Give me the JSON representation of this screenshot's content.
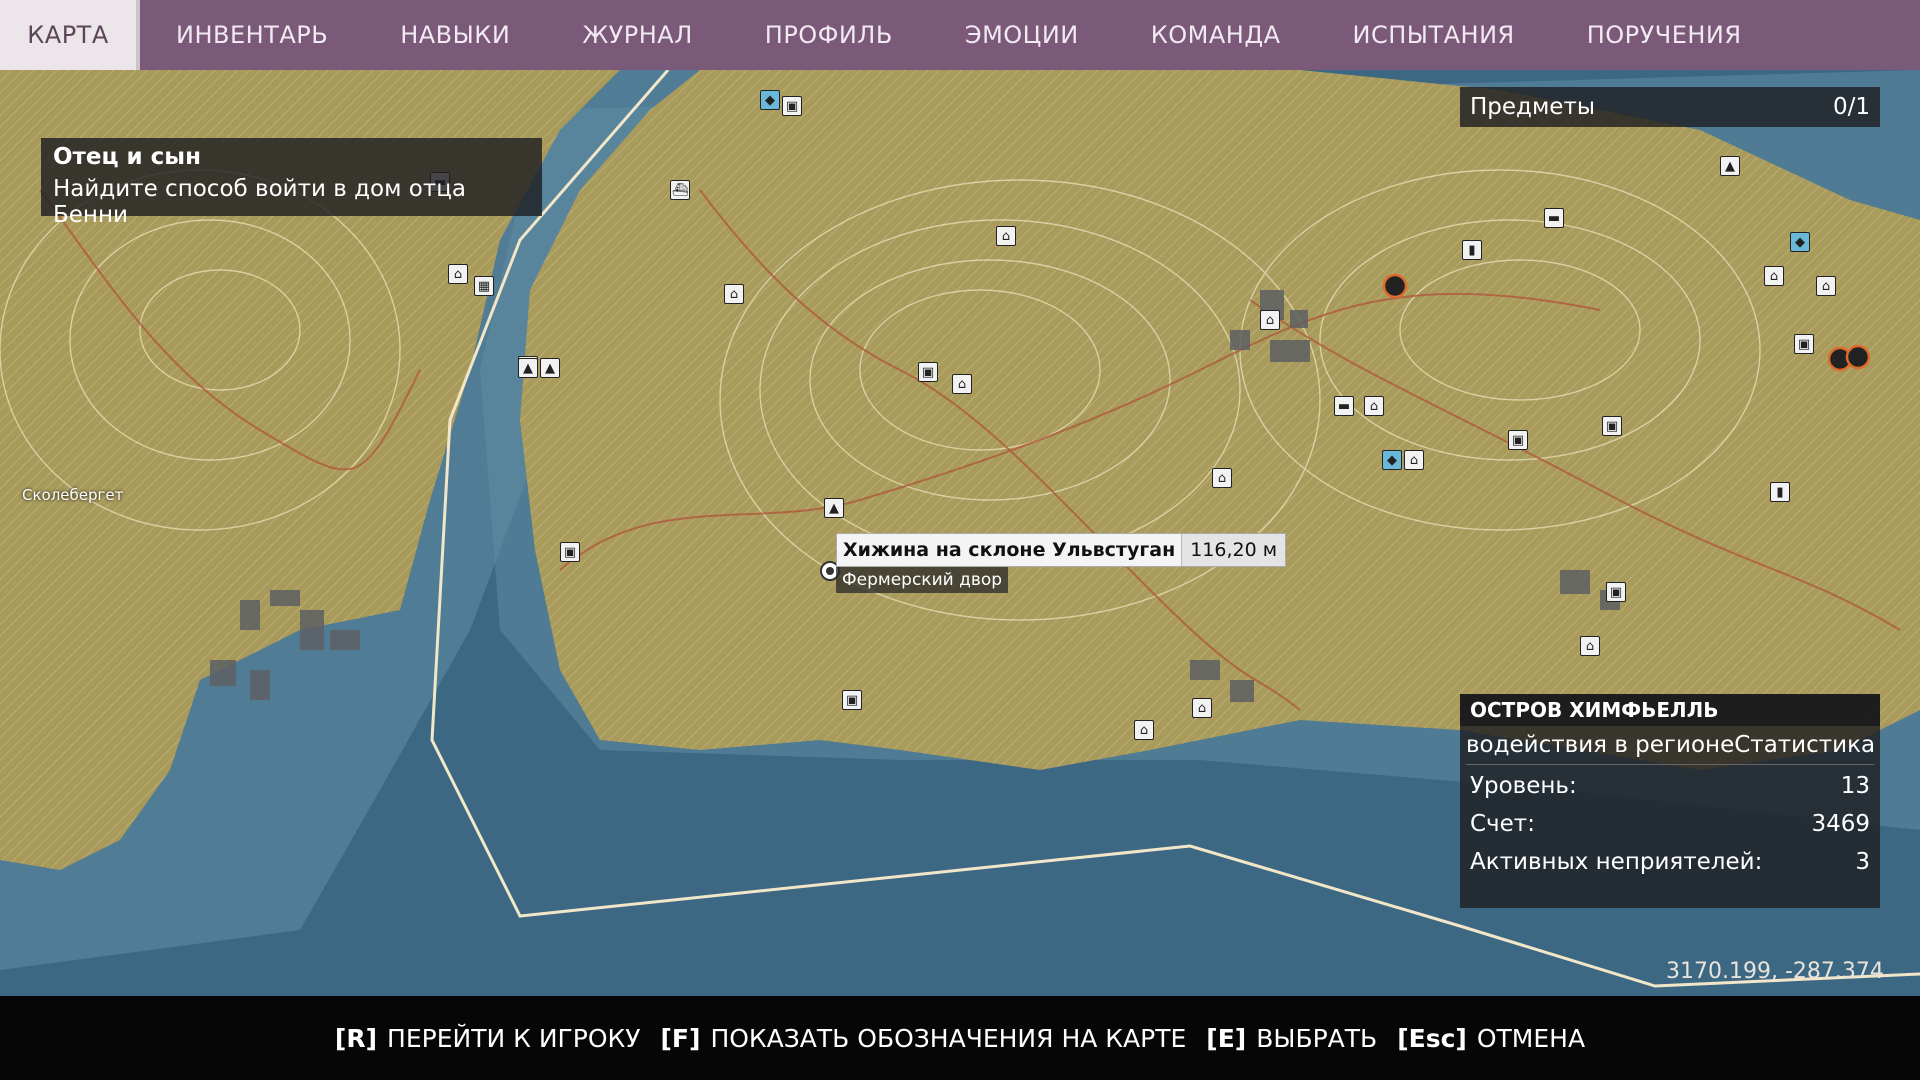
{
  "tabs": [
    "КАРТА",
    "ИНВЕНТАРЬ",
    "НАВЫКИ",
    "ЖУРНАЛ",
    "ПРОФИЛЬ",
    "ЭМОЦИИ",
    "КОМАНДА",
    "ИСПЫТАНИЯ",
    "ПОРУЧЕНИЯ"
  ],
  "active_tab": "КАРТА",
  "quest": {
    "title": "Отец и сын",
    "description": "Найдите способ войти в дом отца Бенни"
  },
  "items_tracker": {
    "label": "Предметы",
    "count": "0/1"
  },
  "region": {
    "title": "ОСТРОВ ХИМФЬЕЛЛЬ",
    "tab_left": "водействия в регионе",
    "tab_right": "Статистика",
    "rows": [
      {
        "label": "Уровень:",
        "value": "13"
      },
      {
        "label": "Счет:",
        "value": "3469"
      },
      {
        "label": "Активных неприятелей:",
        "value": "3"
      }
    ]
  },
  "tooltip": {
    "name": "Хижина на склоне Ульвстуган",
    "distance": "116,20 м",
    "subtitle": "Фермерский двор"
  },
  "town_label": "Сколебергет",
  "coords": "3170.199, -287.374",
  "hints": [
    {
      "key": "[R]",
      "label": "ПЕРЕЙТИ К ИГРОКУ"
    },
    {
      "key": "[F]",
      "label": "ПОКАЗАТЬ ОБОЗНАЧЕНИЯ НА КАРТЕ"
    },
    {
      "key": "[E]",
      "label": "ВЫБРАТЬ"
    },
    {
      "key": "[Esc]",
      "label": "ОТМЕНА"
    }
  ],
  "colors": {
    "tabbar": "#7a5a78",
    "sea": "#3c6580",
    "land": "#a89b5c",
    "border_line": "#f1e6c8",
    "enemy_marker": "#e06a2a"
  }
}
